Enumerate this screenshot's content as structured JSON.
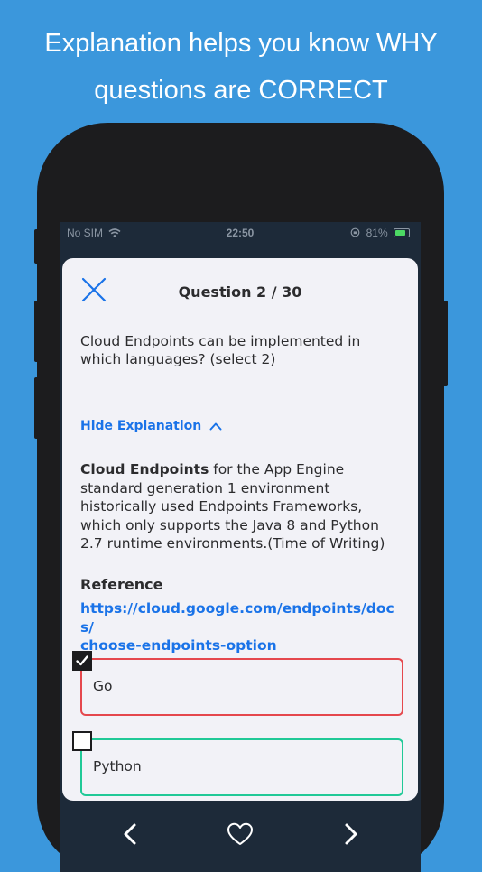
{
  "headline": {
    "line1": "Explanation helps you know WHY",
    "line2": "questions are CORRECT"
  },
  "status_bar": {
    "carrier": "No SIM",
    "time": "22:50",
    "battery": "81%",
    "battery_level": 0.81,
    "icons": [
      "wifi-icon",
      "orientation-lock-icon",
      "battery-charging-icon"
    ]
  },
  "question": {
    "title": "Question 2 / 30",
    "text": "Cloud Endpoints can be implemented in which languages? (select 2)",
    "toggle_label": "Hide Explanation"
  },
  "explanation": {
    "bold_term": "Cloud Endpoints",
    "body": " for the App Engine standard generation 1 environment historically used Endpoints Frameworks, which only supports the Java 8 and Python 2.7 runtime environments.(Time of Writing)",
    "reference_label": "Reference",
    "reference_link_line1": "https://cloud.google.com/endpoints/docs/",
    "reference_link_line2": "choose-endpoints-option"
  },
  "options": [
    {
      "label": "Go",
      "checked": true,
      "border_color": "#e5484d"
    },
    {
      "label": "Python",
      "checked": false,
      "border_color": "#20c997"
    }
  ],
  "colors": {
    "background": "#3b97dc",
    "accent": "#1a73e8",
    "wrong": "#e5484d",
    "correct": "#20c997"
  },
  "bottom_nav": [
    "chevron-left-icon",
    "heart-icon",
    "chevron-right-icon"
  ]
}
